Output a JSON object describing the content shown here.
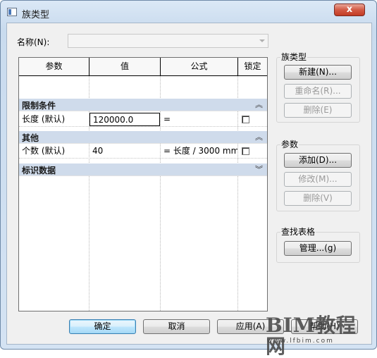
{
  "window": {
    "title": "族类型",
    "close_label": "x"
  },
  "name_field": {
    "label": "名称(N):",
    "value": ""
  },
  "grid": {
    "headers": [
      "参数",
      "值",
      "公式",
      "锁定"
    ],
    "groups": [
      {
        "label": "限制条件",
        "chevron": "︽",
        "rows": [
          {
            "param": "长度 (默认)",
            "value": "120000.0",
            "formula": "=",
            "locked": false
          }
        ]
      },
      {
        "label": "其他",
        "chevron": "︽",
        "rows": [
          {
            "param": "个数 (默认)",
            "value": "40",
            "formula": "= 长度 / 3000 mm",
            "locked": false
          }
        ]
      },
      {
        "label": "标识数据",
        "chevron": "︾",
        "rows": []
      }
    ]
  },
  "family_types_group": {
    "title": "族类型",
    "new_label": "新建(N)...",
    "rename_label": "重命名(R)...",
    "delete_label": "删除(E)"
  },
  "params_group": {
    "title": "参数",
    "add_label": "添加(D)...",
    "modify_label": "修改(M)...",
    "delete_label": "删除(V)"
  },
  "lookup_group": {
    "title": "查找表格",
    "manage_label": "管理...(g)"
  },
  "footer": {
    "ok_label": "确定",
    "cancel_label": "取消",
    "apply_label": "应用(A)",
    "help_label": "帮助(H)"
  },
  "watermark": {
    "text": "BIM教程网",
    "url": "www.lfbim.com"
  }
}
